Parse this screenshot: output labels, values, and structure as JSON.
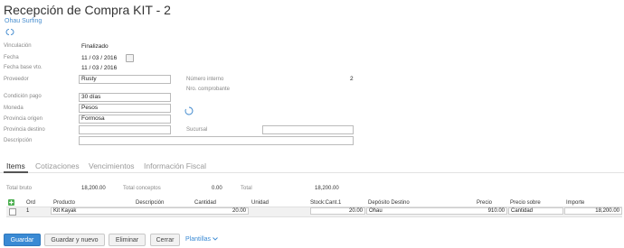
{
  "header": {
    "title": "Recepción de Compra KIT - 2",
    "company": "Ohau Surfing"
  },
  "form": {
    "vinculacion": {
      "label": "Vinculación",
      "value": "Finalizado"
    },
    "fecha": {
      "label": "Fecha",
      "day": "11",
      "month": "03",
      "year": "2016"
    },
    "fecha_base": {
      "label": "Fecha base vto.",
      "day": "11",
      "month": "03",
      "year": "2016"
    },
    "proveedor": {
      "label": "Proveedor",
      "value": "Rusty"
    },
    "numero_interno": {
      "label": "Número interno",
      "value": "2"
    },
    "nro_comprobante": {
      "label": "Nro. comprobante",
      "value": ""
    },
    "condicion_pago": {
      "label": "Condición pago",
      "value": "30 días"
    },
    "moneda": {
      "label": "Moneda",
      "value": "Pesos"
    },
    "provincia_origen": {
      "label": "Provincia origen",
      "value": "Formosa"
    },
    "provincia_destino": {
      "label": "Provincia destino",
      "value": ""
    },
    "sucursal": {
      "label": "Sucursal",
      "value": ""
    },
    "descripcion": {
      "label": "Descripción",
      "value": ""
    }
  },
  "tabs": [
    {
      "label": "Items",
      "active": true
    },
    {
      "label": "Cotizaciones",
      "active": false
    },
    {
      "label": "Vencimientos",
      "active": false
    },
    {
      "label": "Información Fiscal",
      "active": false
    }
  ],
  "totals": {
    "total_bruto_label": "Total bruto",
    "total_bruto": "18,200.00",
    "total_conceptos_label": "Total conceptos",
    "total_conceptos": "0.00",
    "total_label": "Total",
    "total": "18,200.00"
  },
  "table": {
    "columns": [
      "Ord",
      "Producto",
      "Descripción",
      "Cantidad",
      "Unidad",
      "Stock:Cant.1",
      "Depósito Destino",
      "Precio",
      "Precio sobre",
      "Importe"
    ],
    "rows": [
      {
        "ord": "1",
        "producto": "Kit Kayak",
        "descripcion": "",
        "cantidad": "20.00",
        "unidad": "",
        "stock": "20.00",
        "deposito": "Ohau",
        "precio": "910.00",
        "precio_sobre": "Cantidad",
        "importe": "18,200.00"
      }
    ]
  },
  "buttons": {
    "guardar": "Guardar",
    "guardar_nuevo": "Guardar y nuevo",
    "eliminar": "Eliminar",
    "cerrar": "Cerrar",
    "plantillas": "Plantillas"
  },
  "colors": {
    "accent": "#3a8ad4",
    "add_icon": "#4caf50"
  }
}
